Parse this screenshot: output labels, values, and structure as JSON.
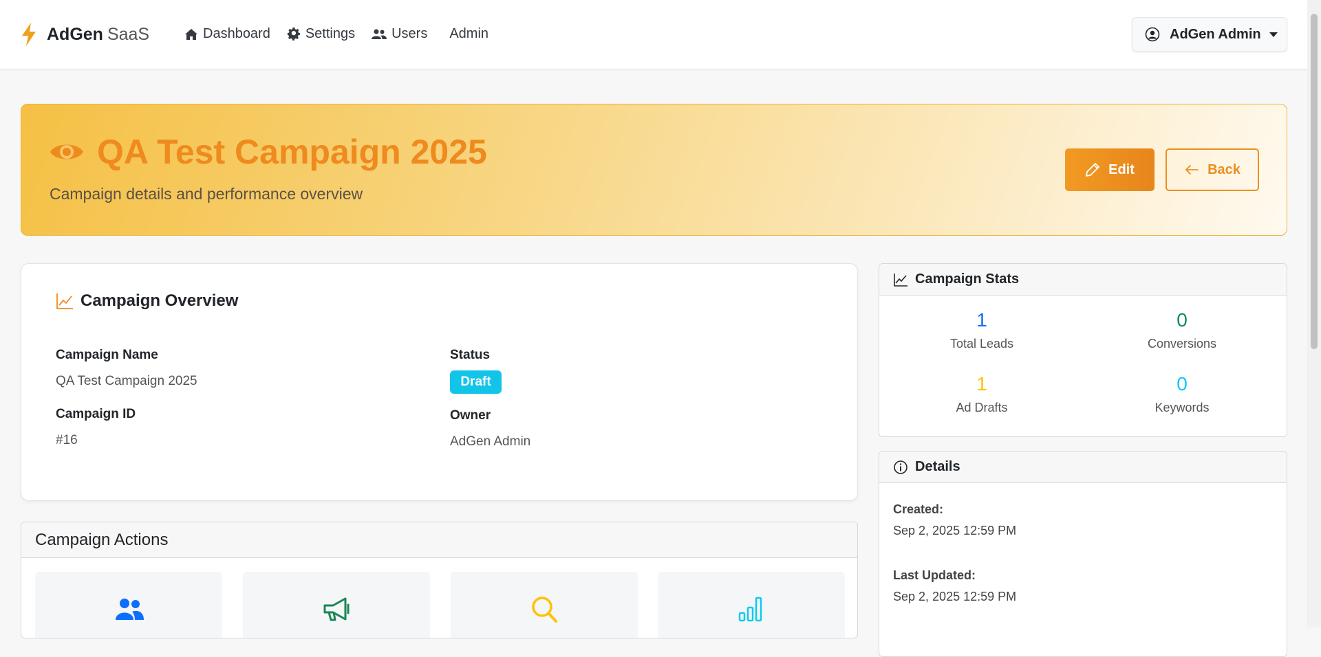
{
  "navbar": {
    "brand_bold": "AdGen",
    "brand_light": "SaaS",
    "links": {
      "dashboard": "Dashboard",
      "settings": "Settings",
      "users": "Users",
      "admin": "Admin"
    },
    "user_menu": "AdGen Admin"
  },
  "hero": {
    "title": "QA Test Campaign 2025",
    "subtitle": "Campaign details and performance overview",
    "edit_label": "Edit",
    "back_label": "Back"
  },
  "overview": {
    "title": "Campaign Overview",
    "name_label": "Campaign Name",
    "name_value": "QA Test Campaign 2025",
    "status_label": "Status",
    "status_value": "Draft",
    "id_label": "Campaign ID",
    "id_value": "#16",
    "owner_label": "Owner",
    "owner_value": "AdGen Admin"
  },
  "actions": {
    "title": "Campaign Actions",
    "tiles": [
      {
        "icon": "users-icon",
        "color": "#0d6efd"
      },
      {
        "icon": "megaphone-icon",
        "color": "#198754"
      },
      {
        "icon": "search-icon",
        "color": "#ffc107"
      },
      {
        "icon": "bar-chart-icon",
        "color": "#0dcaf0"
      }
    ]
  },
  "stats": {
    "title": "Campaign Stats",
    "total_leads": {
      "value": "1",
      "label": "Total Leads",
      "color": "#0d6efd"
    },
    "conversions": {
      "value": "0",
      "label": "Conversions",
      "color": "#198754"
    },
    "ad_drafts": {
      "value": "1",
      "label": "Ad Drafts",
      "color": "#ffc107"
    },
    "keywords": {
      "value": "0",
      "label": "Keywords",
      "color": "#0dcaf0"
    }
  },
  "details": {
    "title": "Details",
    "created_label": "Created:",
    "created_value": "Sep 2, 2025 12:59 PM",
    "updated_label": "Last Updated:",
    "updated_value": "Sep 2, 2025 12:59 PM"
  },
  "colors": {
    "accent": "#ef8a1e",
    "draft_badge": "#12c5e8"
  }
}
